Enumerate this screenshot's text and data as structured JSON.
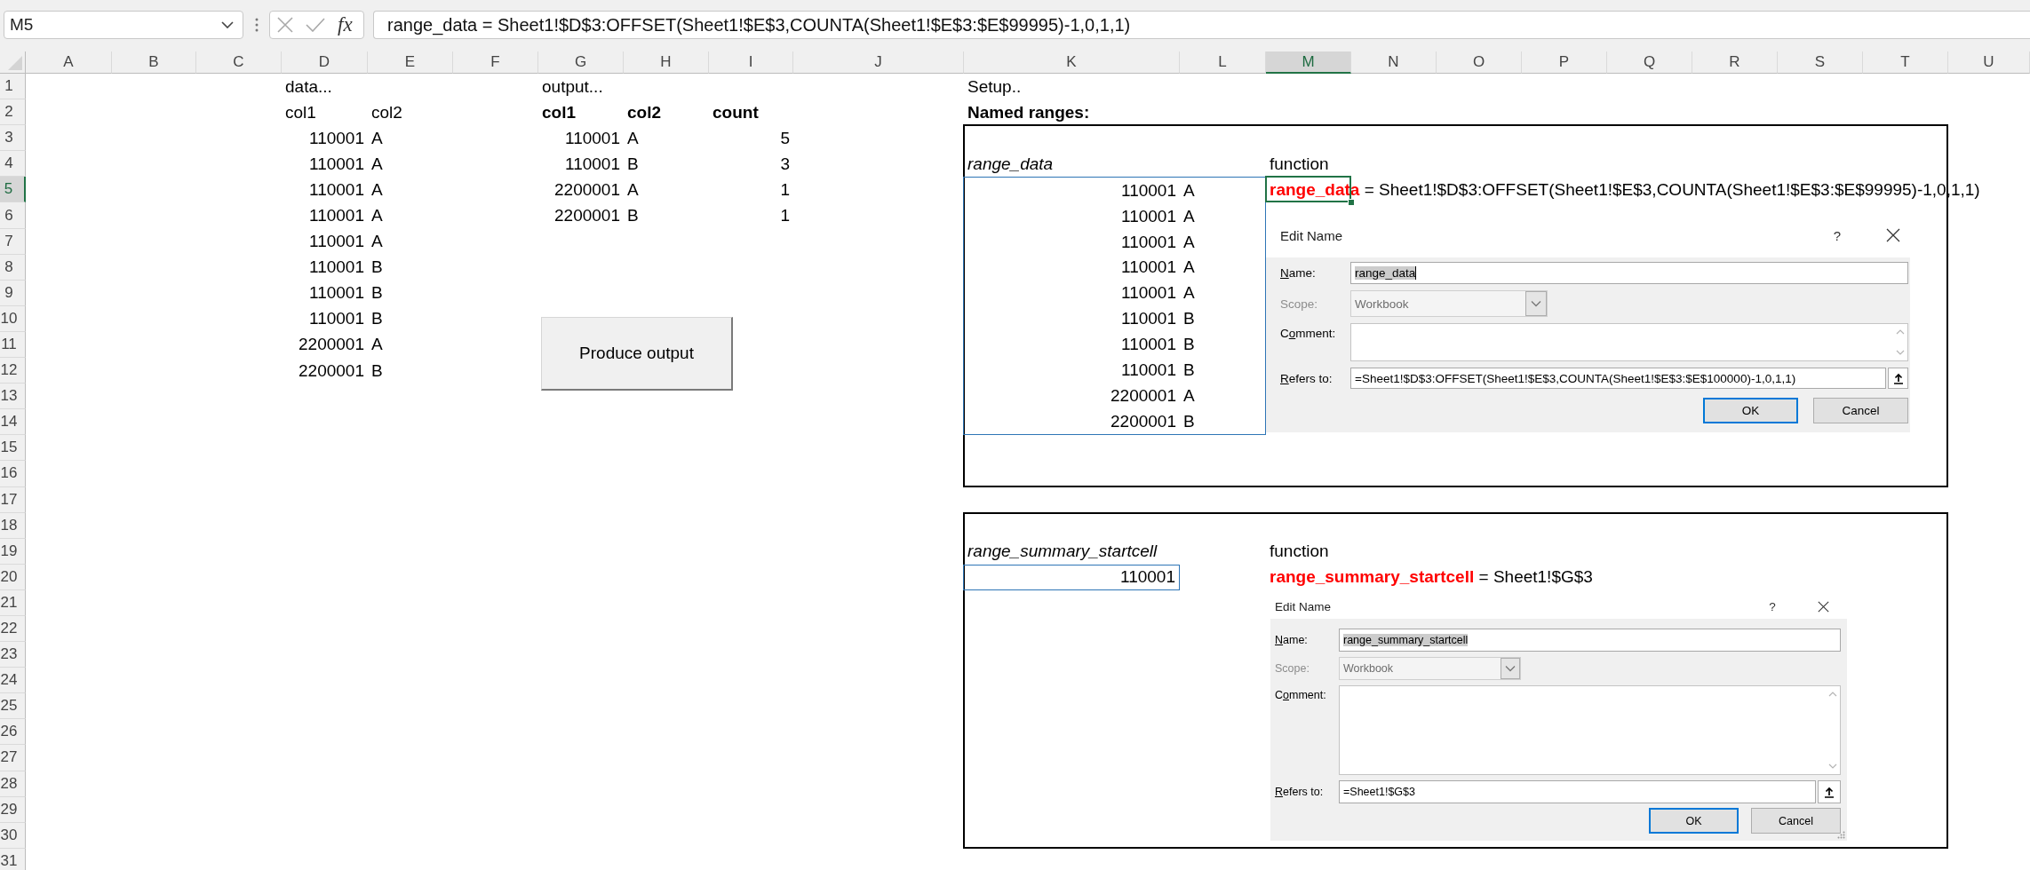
{
  "formula_bar": {
    "name_box": "M5",
    "editing": false,
    "insert_function": "fx",
    "formula": "range_data = Sheet1!$D$3:OFFSET(Sheet1!$E$3,COUNTA(Sheet1!$E$3:$E$99995)-1,0,1,1)"
  },
  "column_headers": [
    {
      "label": "A",
      "selected": false
    },
    {
      "label": "B",
      "selected": false
    },
    {
      "label": "C",
      "selected": false
    },
    {
      "label": "D",
      "selected": false
    },
    {
      "label": "E",
      "selected": false
    },
    {
      "label": "F",
      "selected": false
    },
    {
      "label": "G",
      "selected": false
    },
    {
      "label": "H",
      "selected": false
    },
    {
      "label": "I",
      "selected": false
    },
    {
      "label": "J",
      "selected": false
    },
    {
      "label": "K",
      "selected": false
    },
    {
      "label": "L",
      "selected": false
    },
    {
      "label": "M",
      "selected": true
    },
    {
      "label": "N",
      "selected": false
    },
    {
      "label": "O",
      "selected": false
    },
    {
      "label": "P",
      "selected": false
    },
    {
      "label": "Q",
      "selected": false
    },
    {
      "label": "R",
      "selected": false
    },
    {
      "label": "S",
      "selected": false
    },
    {
      "label": "T",
      "selected": false
    },
    {
      "label": "U",
      "selected": false
    }
  ],
  "row_headers": [
    {
      "label": "1",
      "selected": false
    },
    {
      "label": "2",
      "selected": false
    },
    {
      "label": "3",
      "selected": false
    },
    {
      "label": "4",
      "selected": false
    },
    {
      "label": "5",
      "selected": true
    },
    {
      "label": "6",
      "selected": false
    },
    {
      "label": "7",
      "selected": false
    },
    {
      "label": "8",
      "selected": false
    },
    {
      "label": "9",
      "selected": false
    },
    {
      "label": "10",
      "selected": false
    },
    {
      "label": "11",
      "selected": false
    },
    {
      "label": "12",
      "selected": false
    },
    {
      "label": "13",
      "selected": false
    },
    {
      "label": "14",
      "selected": false
    },
    {
      "label": "15",
      "selected": false
    },
    {
      "label": "16",
      "selected": false
    },
    {
      "label": "17",
      "selected": false
    },
    {
      "label": "18",
      "selected": false
    },
    {
      "label": "19",
      "selected": false
    },
    {
      "label": "20",
      "selected": false
    },
    {
      "label": "21",
      "selected": false
    },
    {
      "label": "22",
      "selected": false
    },
    {
      "label": "23",
      "selected": false
    },
    {
      "label": "24",
      "selected": false
    },
    {
      "label": "25",
      "selected": false
    },
    {
      "label": "26",
      "selected": false
    },
    {
      "label": "27",
      "selected": false
    },
    {
      "label": "28",
      "selected": false
    },
    {
      "label": "29",
      "selected": false
    },
    {
      "label": "30",
      "selected": false
    },
    {
      "label": "31",
      "selected": false
    }
  ],
  "data_section": {
    "title": "data...",
    "columns": [
      "col1",
      "col2"
    ],
    "rows": [
      [
        "110001",
        "A"
      ],
      [
        "110001",
        "A"
      ],
      [
        "110001",
        "A"
      ],
      [
        "110001",
        "A"
      ],
      [
        "110001",
        "A"
      ],
      [
        "110001",
        "B"
      ],
      [
        "110001",
        "B"
      ],
      [
        "110001",
        "B"
      ],
      [
        "2200001",
        "A"
      ],
      [
        "2200001",
        "B"
      ]
    ]
  },
  "output_section": {
    "title": "output...",
    "columns": [
      "col1",
      "col2",
      "count"
    ],
    "rows": [
      [
        "110001",
        "A",
        "5"
      ],
      [
        "110001",
        "B",
        "3"
      ],
      [
        "2200001",
        "A",
        "1"
      ],
      [
        "2200001",
        "B",
        "1"
      ]
    ]
  },
  "produce_button": {
    "label": "Produce output"
  },
  "setup": {
    "title": "Setup..",
    "heading": "Named ranges:",
    "panels": [
      {
        "range_name": "range_data",
        "range_cells": [
          [
            "110001",
            "A"
          ],
          [
            "110001",
            "A"
          ],
          [
            "110001",
            "A"
          ],
          [
            "110001",
            "A"
          ],
          [
            "110001",
            "A"
          ],
          [
            "110001",
            "B"
          ],
          [
            "110001",
            "B"
          ],
          [
            "110001",
            "B"
          ],
          [
            "2200001",
            "A"
          ],
          [
            "2200001",
            "B"
          ]
        ],
        "function_label": "function",
        "definition": "**range_data** = Sheet1!$D$3:OFFSET(Sheet1!$E$3,COUNTA(Sheet1!$E$3:$E$99995)-1,0,1,1)",
        "selected": true,
        "dialog": {
          "title": "Edit Name",
          "help": "?",
          "resize_grip": false,
          "fields": [
            {
              "kind": "text",
              "label": [
                {
                  "text": "N",
                  "underline": true
                },
                {
                  "text": "ame:",
                  "underline": false
                }
              ],
              "value": "range_data",
              "value_selected": true,
              "cursor": true,
              "disabled": false
            },
            {
              "kind": "dropdown",
              "label": [
                {
                  "text": "Scope:",
                  "underline": false
                }
              ],
              "value": "Workbook",
              "disabled": true
            },
            {
              "kind": "textarea",
              "label": [
                {
                  "text": "C",
                  "underline": false
                },
                {
                  "text": "o",
                  "underline": true
                },
                {
                  "text": "mment:",
                  "underline": false
                }
              ],
              "disabled": false
            },
            {
              "kind": "reference",
              "label": [
                {
                  "text": "R",
                  "underline": true
                },
                {
                  "text": "efers to:",
                  "underline": false
                }
              ],
              "value": "=Sheet1!$D$3:OFFSET(Sheet1!$E$3,COUNTA(Sheet1!$E$3:$E$100000)-1,0,1,1)",
              "disabled": false
            }
          ],
          "buttons": [
            {
              "label": "OK",
              "default": true
            },
            {
              "label": "Cancel",
              "default": false
            }
          ]
        }
      },
      {
        "range_name": "range_summary_startcell",
        "range_cells": [
          [
            "110001"
          ]
        ],
        "function_label": "function",
        "definition": "**range_summary_startcell** = Sheet1!$G$3",
        "selected": false,
        "dialog": {
          "title": "Edit Name",
          "help": "?",
          "resize_grip": true,
          "fields": [
            {
              "kind": "text",
              "label": [
                {
                  "text": "N",
                  "underline": true
                },
                {
                  "text": "ame:",
                  "underline": false
                }
              ],
              "value": "range_summary_startcell",
              "value_selected": true,
              "cursor": false,
              "disabled": false
            },
            {
              "kind": "dropdown",
              "label": [
                {
                  "text": "Scope:",
                  "underline": false
                }
              ],
              "value": "Workbook",
              "disabled": true
            },
            {
              "kind": "textarea",
              "label": [
                {
                  "text": "C",
                  "underline": false
                },
                {
                  "text": "o",
                  "underline": true
                },
                {
                  "text": "mment:",
                  "underline": false
                }
              ],
              "disabled": false
            },
            {
              "kind": "reference",
              "label": [
                {
                  "text": "R",
                  "underline": true
                },
                {
                  "text": "efers to:",
                  "underline": false
                }
              ],
              "value": "=Sheet1!$G$3",
              "disabled": false
            }
          ],
          "buttons": [
            {
              "label": "OK",
              "default": true
            },
            {
              "label": "Cancel",
              "default": false
            }
          ]
        }
      }
    ]
  }
}
